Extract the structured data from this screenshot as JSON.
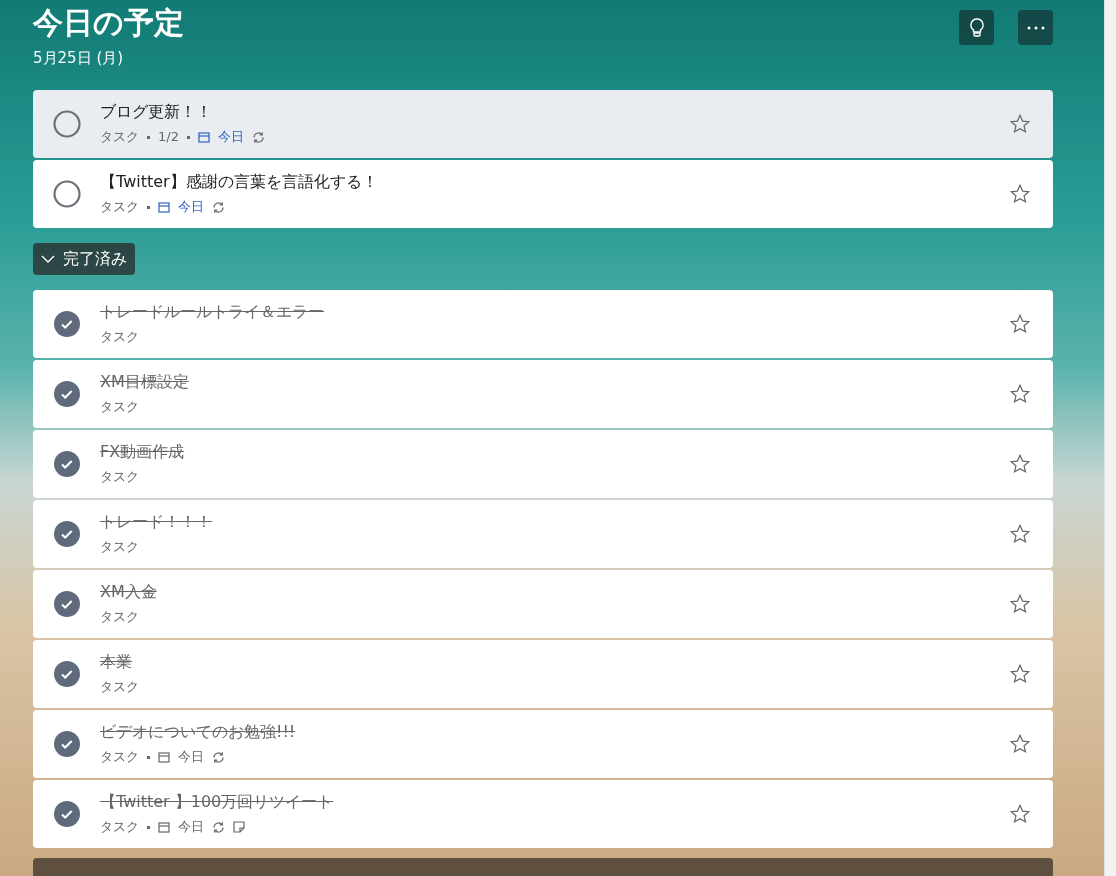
{
  "header": {
    "title": "今日の予定",
    "date": "5月25日 (月)"
  },
  "toolbar": [
    {
      "kind": "bulb"
    },
    {
      "kind": "more"
    }
  ],
  "tasks": [
    {
      "title": "ブログ更新！！",
      "list": "タスク",
      "steps": "1/2",
      "due": "今日",
      "repeat": true,
      "note": false,
      "completed": false,
      "selected": true,
      "starred": false
    },
    {
      "title": "【Twitter】感謝の言葉を言語化する！",
      "list": "タスク",
      "due": "今日",
      "repeat": true,
      "note": false,
      "completed": false,
      "selected": false,
      "starred": false
    }
  ],
  "completed_section": {
    "label": "完了済み",
    "expanded": true,
    "tasks": [
      {
        "title": "トレードルールトライ＆エラー",
        "list": "タスク",
        "repeat": false,
        "note": false,
        "completed": true,
        "selected": false,
        "starred": false
      },
      {
        "title": "XM目標設定",
        "list": "タスク",
        "repeat": false,
        "note": false,
        "completed": true,
        "selected": false,
        "starred": false
      },
      {
        "title": "FX動画作成",
        "list": "タスク",
        "repeat": false,
        "note": false,
        "completed": true,
        "selected": false,
        "starred": false
      },
      {
        "title": "トレード！！！",
        "list": "タスク",
        "repeat": false,
        "note": false,
        "completed": true,
        "selected": false,
        "starred": false
      },
      {
        "title": "XM入金",
        "list": "タスク",
        "repeat": false,
        "note": false,
        "completed": true,
        "selected": false,
        "starred": false
      },
      {
        "title": "本業",
        "list": "タスク",
        "repeat": false,
        "note": false,
        "completed": true,
        "selected": false,
        "starred": false
      },
      {
        "title": "ビデオについてのお勉強!!!",
        "list": "タスク",
        "due": "今日",
        "repeat": true,
        "note": false,
        "completed": true,
        "selected": false,
        "starred": false
      },
      {
        "title": "【Twitter 】100万回リツイート",
        "list": "タスク",
        "due": "今日",
        "repeat": true,
        "note": true,
        "completed": true,
        "selected": false,
        "starred": false
      }
    ]
  }
}
